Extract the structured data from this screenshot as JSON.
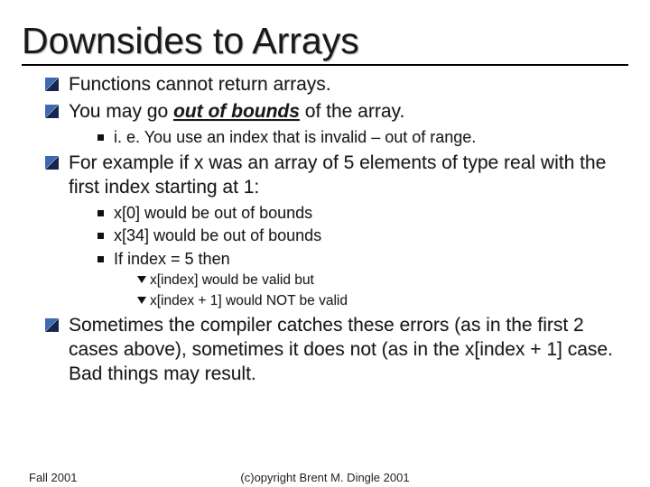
{
  "title": "Downsides to Arrays",
  "bullets": {
    "b1": "Functions cannot return arrays.",
    "b2_pre": "You may go ",
    "b2_em": "out of bounds",
    "b2_post": " of the array.",
    "b2_sub1": "i. e. You use an index that is invalid – out of range.",
    "b3": "For example if x was an array of 5 elements of type real with the first index starting at 1:",
    "b3_sub1": "x[0] would be out of bounds",
    "b3_sub2": "x[34] would be out of bounds",
    "b3_sub3": "If index = 5 then",
    "b3_sub3_a": "x[index] would be valid but",
    "b3_sub3_b": "x[index + 1] would NOT be valid",
    "b4": "Sometimes the compiler catches these errors (as in the first 2 cases above), sometimes it does not (as in the x[index + 1] case. Bad things may result."
  },
  "footer": {
    "left": "Fall 2001",
    "center": "(c)opyright Brent M. Dingle 2001"
  }
}
